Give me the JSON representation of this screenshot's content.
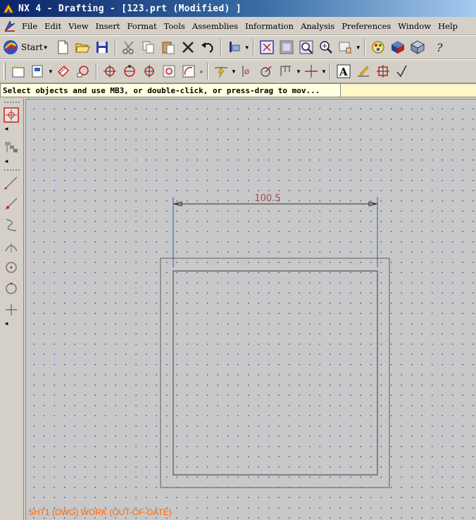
{
  "window": {
    "title": "NX 4 - Drafting - [123.prt (Modified) ]"
  },
  "menu": {
    "items": [
      "File",
      "Edit",
      "View",
      "Insert",
      "Format",
      "Tools",
      "Assemblies",
      "Information",
      "Analysis",
      "Preferences",
      "Window",
      "Help"
    ]
  },
  "toolbar": {
    "start_label": "Start"
  },
  "prompt": {
    "text": "Select objects and use MB3, or double-click, or press-drag to mov..."
  },
  "drawing": {
    "dimension_value": "100.5"
  },
  "status": {
    "text": "SHT1 (DWG) WORK (OUT-OF-DATE)"
  },
  "colors": {
    "title_start": "#0a246a",
    "title_end": "#a6caf0",
    "canvas_bg": "#c8c8c8",
    "grid_dot": "#3a4ec0",
    "dimension_text": "#a05050",
    "extension_line": "#2060c0",
    "geometry": "#808080",
    "status_text": "#ff6600"
  }
}
